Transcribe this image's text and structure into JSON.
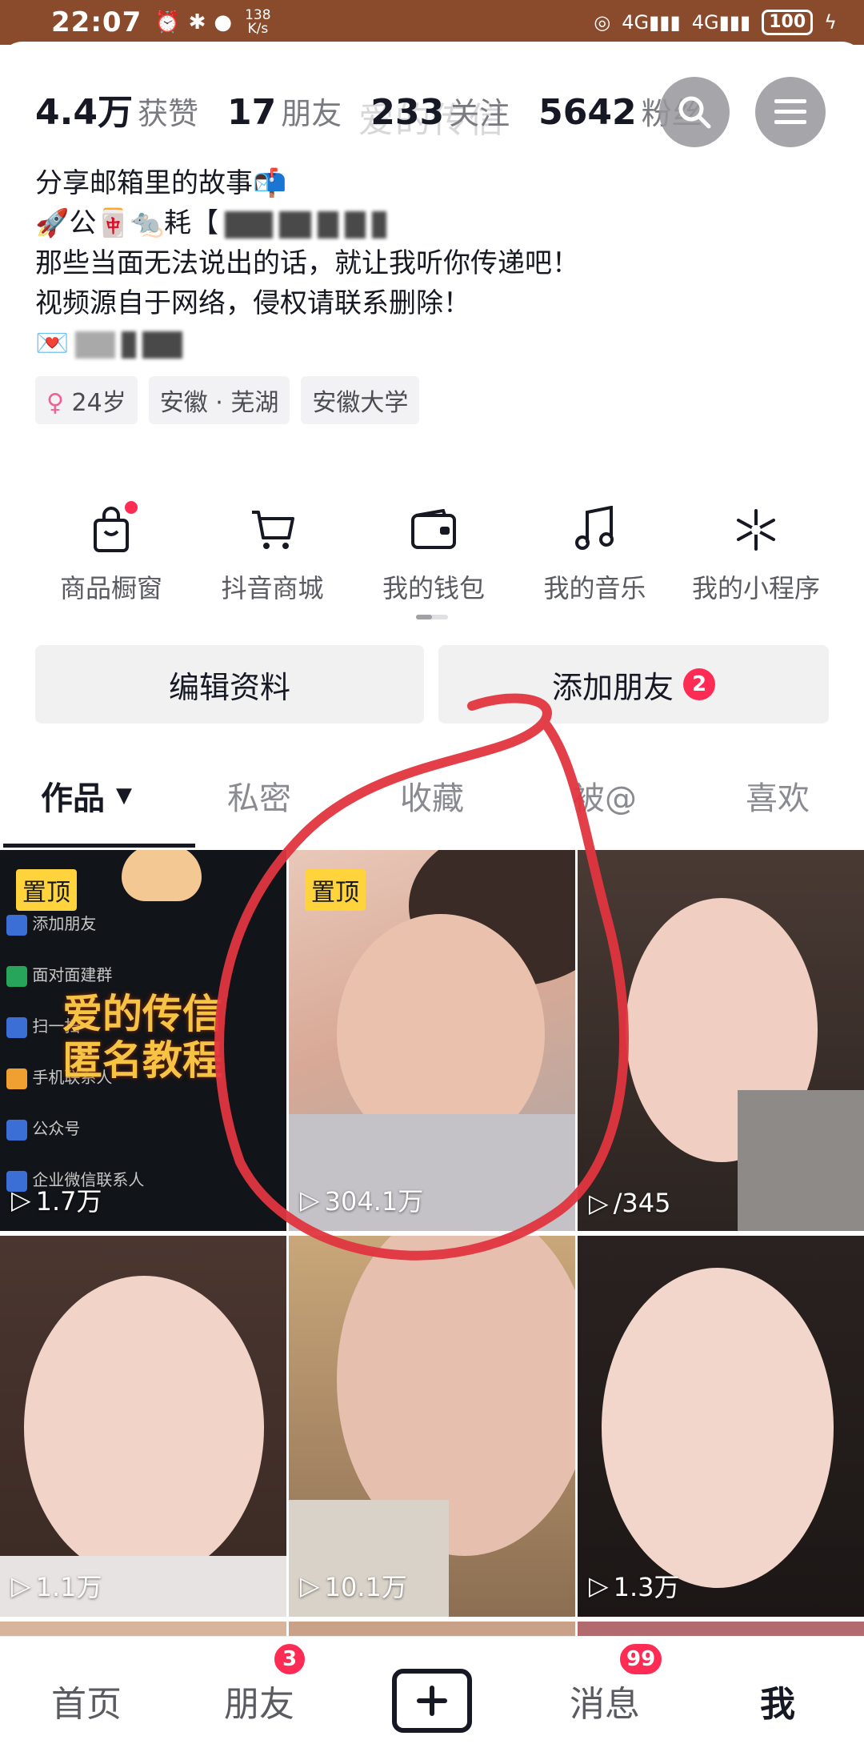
{
  "status_bar": {
    "time": "22:07",
    "speed_top": "138",
    "speed_bottom": "K/s",
    "net1": "4G",
    "net2": "4G",
    "battery": "100"
  },
  "profile": {
    "ghost_title": "爱的传信",
    "stats": [
      {
        "value": "4.4万",
        "label": "获赞"
      },
      {
        "value": "17",
        "label": "朋友"
      },
      {
        "value": "233",
        "label": "关注"
      },
      {
        "value": "5642",
        "label": "粉丝"
      }
    ],
    "bio": {
      "line1": "分享邮箱里的故事📬",
      "line2": "🚀公🀄🐀耗【",
      "line3": "那些当面无法说出的话，就让我听你传递吧！",
      "line4": "视频源自于网络，侵权请联系删除！",
      "line5": "💌"
    },
    "tags": [
      "♀",
      "24岁",
      "安徽 · 芜湖",
      "安徽大学"
    ]
  },
  "tools": [
    {
      "label": "商品橱窗",
      "icon": "shopping-bag-icon"
    },
    {
      "label": "抖音商城",
      "icon": "cart-icon"
    },
    {
      "label": "我的钱包",
      "icon": "wallet-icon"
    },
    {
      "label": "我的音乐",
      "icon": "music-note-icon"
    },
    {
      "label": "我的小程序",
      "icon": "mini-program-icon"
    }
  ],
  "actions": {
    "edit": "编辑资料",
    "add_friend": "添加朋友",
    "add_friend_badge": "2"
  },
  "tabs": [
    "作品",
    "私密",
    "收藏",
    "被@",
    "喜欢"
  ],
  "videos": [
    {
      "plays": "1.7万",
      "pinned": "置顶",
      "overlay": "爱的传信\n匿名教程"
    },
    {
      "plays": "304.1万",
      "pinned": "置顶"
    },
    {
      "plays": "/345"
    },
    {
      "plays": "1.1万"
    },
    {
      "plays": "10.1万"
    },
    {
      "plays": "1.3万"
    }
  ],
  "tutorial_menu": [
    "添加朋友",
    "面对面建群",
    "扫一扫",
    "手机联系人",
    "公众号",
    "企业微信联系人"
  ],
  "bottom_nav": {
    "home": "首页",
    "friends": "朋友",
    "friends_badge": "3",
    "messages": "消息",
    "messages_badge": "99",
    "me": "我"
  },
  "colors": {
    "accent": "#fe2c55",
    "pin": "#fed33c",
    "annotation": "#e0353f"
  }
}
